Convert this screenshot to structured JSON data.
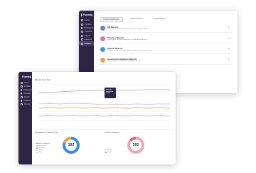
{
  "top_window": {
    "brand": "Fluentiq",
    "nav": [
      "Home",
      "Portfolio",
      "Participants",
      "Transfers",
      "Payroll",
      "Deposits",
      "Reports"
    ],
    "active_nav": 6,
    "tabs": [
      "Customized Reports",
      "Recent Reports",
      "Saved Reports"
    ],
    "active_tab": 0,
    "reports": [
      {
        "title": "HR Reports",
        "desc": "View your detailed workforce reports across all your HR data",
        "color": "#6f7ec9"
      },
      {
        "title": "Previous Reports",
        "desc": "View reports you have previously run and download them",
        "color": "#e0749a"
      },
      {
        "title": "Deposit Reports",
        "desc": "View all deposit and funding details to help reconcile your records",
        "color": "#3e9bd4"
      },
      {
        "title": "General & Compliance Reports",
        "desc": "Manage general activity and compliance reports",
        "color": "#e7a54b"
      }
    ]
  },
  "bottom_window": {
    "brand": "Fluentiq",
    "nav": [
      "Home",
      "Portfolio",
      "Participants",
      "Transfers",
      "Payroll",
      "Deposits",
      "Reports"
    ],
    "chart_title": "Balance Over Time",
    "chart_data": {
      "type": "line",
      "x": [
        0,
        1,
        2,
        3,
        4,
        5,
        6,
        7,
        8,
        9,
        10,
        11,
        12
      ],
      "series": [
        {
          "values": [
            78,
            79,
            80,
            82,
            83,
            84,
            85,
            84,
            85,
            85,
            86,
            86,
            86
          ],
          "color": "#9aa0b2"
        },
        {
          "values": [
            46,
            47,
            46,
            48,
            47,
            46,
            44,
            45,
            45,
            46,
            45,
            46,
            46
          ],
          "color": "#c9b7ef"
        },
        {
          "values": [
            34,
            35,
            34,
            35,
            34,
            35,
            34,
            35,
            34,
            35,
            34,
            35,
            34
          ],
          "color": "#e7a54b"
        },
        {
          "values": [
            12,
            13,
            12,
            13,
            12,
            13,
            12,
            13,
            12,
            13,
            12,
            13,
            12
          ],
          "color": "#b0b8d0"
        }
      ],
      "ylim": [
        0,
        100
      ]
    },
    "panel_left_title": "Participants by Gender Type",
    "panel_right_title": "Account Statistics",
    "donut_left": {
      "value": "392",
      "segments": [
        {
          "pct": 80,
          "color": "#3a8fd0"
        },
        {
          "pct": 20,
          "color": "#e7a54b"
        }
      ]
    },
    "donut_right": {
      "value": "392",
      "segments": [
        {
          "pct": 86,
          "color": "#e9a8b6"
        },
        {
          "pct": 14,
          "color": "#c46a86"
        }
      ]
    },
    "legend_left": [
      {
        "label": "Active Employees",
        "color": "#3a8fd0"
      },
      {
        "label": "Terminated",
        "color": "#e7a54b"
      },
      {
        "label": "On Leave",
        "color": "#9aa0b2"
      },
      {
        "label": "Retired",
        "color": "#c9b7ef"
      },
      {
        "label": "Other",
        "color": "#b0b8d0"
      }
    ],
    "legend_right": [
      {
        "label": "Active",
        "color": "#e9a8b6"
      },
      {
        "label": "Inactive",
        "color": "#c46a86"
      }
    ]
  }
}
